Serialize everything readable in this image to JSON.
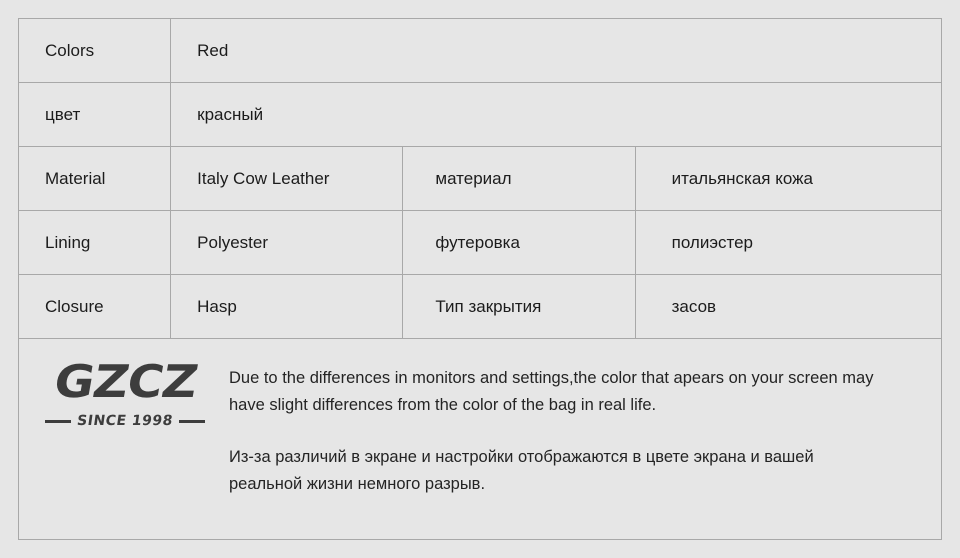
{
  "spec_table": {
    "rows": [
      {
        "id": "colors-en",
        "label": "Colors",
        "value": "Red",
        "ru_label": "",
        "ru_value": "",
        "span": true,
        "highlight": false
      },
      {
        "id": "colors-ru",
        "label": "цвет",
        "value": "красный",
        "ru_label": "",
        "ru_value": "",
        "span": true,
        "highlight": false
      },
      {
        "id": "material",
        "label": "Material",
        "value": "Italy Cow Leather",
        "ru_label": "материал",
        "ru_value": "итальянская кожа",
        "span": false,
        "highlight": true
      },
      {
        "id": "lining",
        "label": "Lining",
        "value": "Polyester",
        "ru_label": "футеровка",
        "ru_value": "полиэстер",
        "span": false,
        "highlight": false
      },
      {
        "id": "closure",
        "label": "Closure",
        "value": "Hasp",
        "ru_label": "Тип закрытия",
        "ru_value": "засов",
        "span": false,
        "highlight": false
      }
    ]
  },
  "footer": {
    "logo": {
      "wordmark": "GZCZ",
      "tagline": "SINCE 1998"
    },
    "disclaimer_en": "Due to the differences in monitors and settings,the color that apears on your screen may have slight differences from the color of the bag in real life.",
    "disclaimer_ru": "Из-за различий в экране и настройки отображаются в цвете экрана и вашей реальной жизни немного разрыв."
  },
  "colors": {
    "page_background": "#e6e6e6",
    "cell_background": "#e6e6e6",
    "highlight_cell_background": "#ffffff",
    "border": "#a8a8a8",
    "text": "#1c1c1c",
    "logo": "#3d3d3d"
  }
}
